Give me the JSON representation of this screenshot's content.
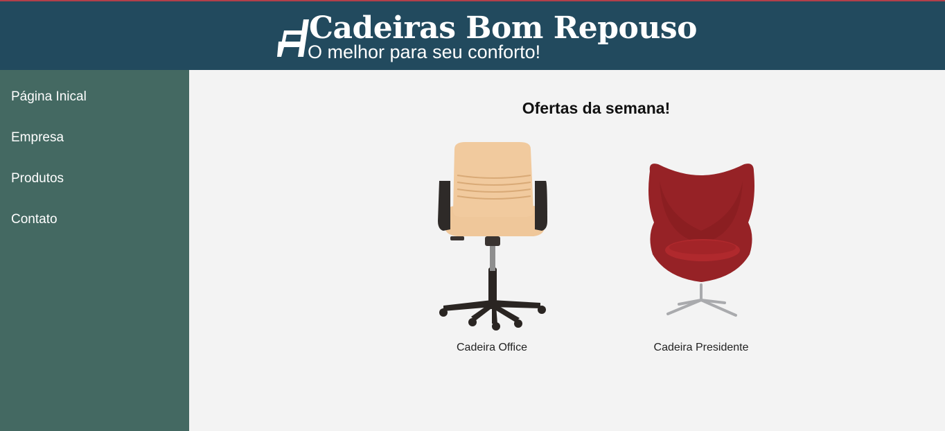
{
  "header": {
    "title": "Cadeiras Bom Repouso",
    "subtitle": "O melhor para seu conforto!",
    "logo_icon": "chair-icon",
    "bg_color": "#224a5e"
  },
  "nav": {
    "bg_color": "#446962",
    "items": [
      {
        "label": "Página Inical"
      },
      {
        "label": "Empresa"
      },
      {
        "label": "Produtos"
      },
      {
        "label": "Contato"
      }
    ]
  },
  "main": {
    "title": "Ofertas da semana!",
    "products": [
      {
        "name": "Cadeira Office",
        "image": "office-chair-image"
      },
      {
        "name": "Cadeira Presidente",
        "image": "egg-chair-image"
      }
    ]
  }
}
